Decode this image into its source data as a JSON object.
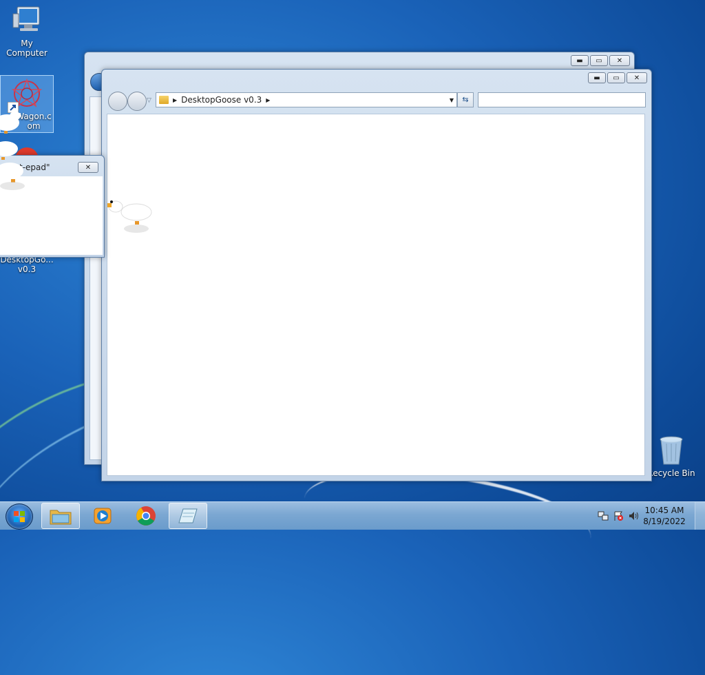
{
  "desktop": {
    "icons": [
      {
        "label": "My Computer"
      },
      {
        "label": "Wagon.c\nom"
      },
      {
        "label": "DesktopGo...\nv0.3"
      },
      {
        "label": "Recycle Bin"
      }
    ]
  },
  "back_window": {
    "caption_buttons": [
      "minimize",
      "maximize",
      "close"
    ]
  },
  "explorer": {
    "address_path": "DesktopGoose v0.3",
    "search_placeholder": "",
    "caption_buttons": [
      "minimize",
      "maximize",
      "close"
    ]
  },
  "notepad_window": {
    "title_fragment": "t-epad\""
  },
  "taskbar": {
    "pinned": [
      {
        "name": "file-explorer"
      },
      {
        "name": "media-player"
      },
      {
        "name": "chrome"
      },
      {
        "name": "notepad"
      }
    ],
    "clock_time": "10:45 AM",
    "clock_date": "8/19/2022"
  },
  "colors": {
    "desktop": "#1a62b8",
    "taskbar": "#7ba7d2",
    "window_frame": "#c3d4e8"
  }
}
